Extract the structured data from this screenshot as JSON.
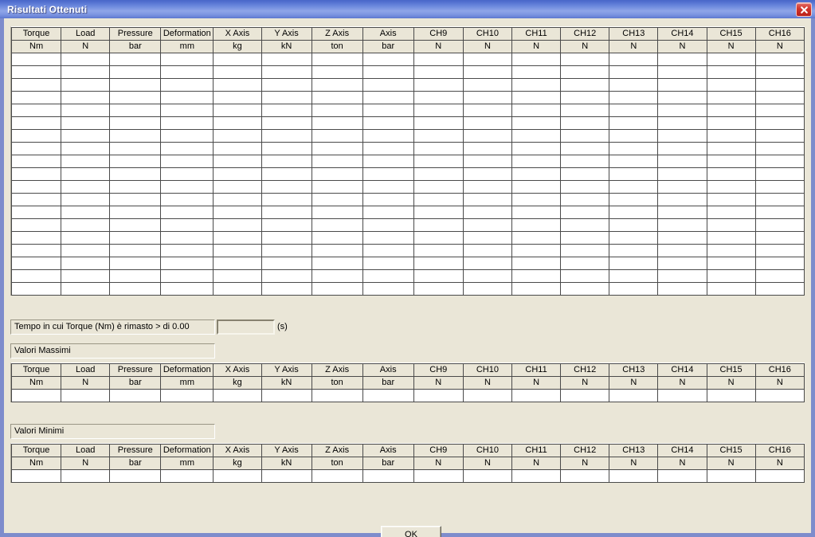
{
  "window": {
    "title": "Risultati Ottenuti",
    "close_icon": "close-icon",
    "accent_color": "#6e8ade",
    "background_color": "#eae6d7",
    "frame_color": "#7e8ccc"
  },
  "table": {
    "columns": [
      {
        "name": "Torque",
        "unit": "Nm"
      },
      {
        "name": "Load",
        "unit": "N"
      },
      {
        "name": "Pressure",
        "unit": "bar"
      },
      {
        "name": "Deformation",
        "unit": "mm"
      },
      {
        "name": "X Axis",
        "unit": "kg"
      },
      {
        "name": "Y Axis",
        "unit": "kN"
      },
      {
        "name": "Z Axis",
        "unit": "ton"
      },
      {
        "name": "Axis",
        "unit": "bar"
      },
      {
        "name": "CH9",
        "unit": "N"
      },
      {
        "name": "CH10",
        "unit": "N"
      },
      {
        "name": "CH11",
        "unit": "N"
      },
      {
        "name": "CH12",
        "unit": "N"
      },
      {
        "name": "CH13",
        "unit": "N"
      },
      {
        "name": "CH14",
        "unit": "N"
      },
      {
        "name": "CH15",
        "unit": "N"
      },
      {
        "name": "CH16",
        "unit": "N"
      }
    ],
    "main_rows": 19,
    "summary_rows": 1,
    "rows": [],
    "max_rows": [],
    "min_rows": []
  },
  "time_field": {
    "label": "Tempo in cui Torque (Nm) è rimasto > di 0.00",
    "value": "",
    "unit_label": "(s)"
  },
  "sections": {
    "max_label": "Valori Massimi",
    "min_label": "Valori Minimi"
  },
  "footer": {
    "ok_label": "OK"
  }
}
